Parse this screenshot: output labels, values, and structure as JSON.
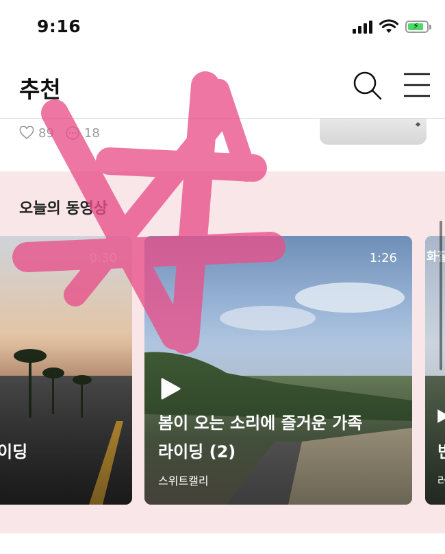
{
  "status_bar": {
    "time": "9:16"
  },
  "header": {
    "title": "추천"
  },
  "previous_post": {
    "likes": "89",
    "comments": "18"
  },
  "video_section": {
    "title": "오늘의 동영상",
    "cards": [
      {
        "duration": "0:30",
        "title_line2": "이딩"
      },
      {
        "duration": "1:26",
        "title_line1": "봄이 오는 소리에 즐거운 가족",
        "title_line2": "라이딩 (2)",
        "author": "스위트캘리"
      },
      {
        "tag": "화잘",
        "title": "빈",
        "author": "러"
      }
    ]
  },
  "colors": {
    "section_bg": "#f8e6e8",
    "scribble": "#e8508a",
    "battery": "#4cd964"
  }
}
